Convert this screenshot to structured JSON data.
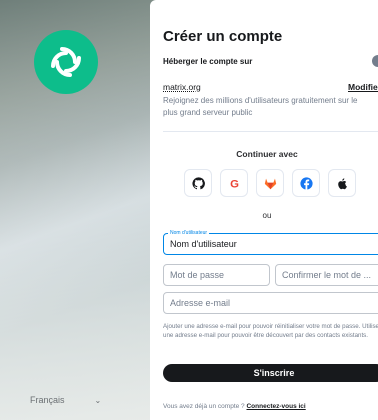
{
  "colors": {
    "accent": "#0dbd8b",
    "primary_button": "#17191c",
    "focus": "#0086e6"
  },
  "language": {
    "selected": "Français"
  },
  "form": {
    "title": "Créer un compte",
    "host_label": "Héberger le compte sur",
    "server_name": "matrix.org",
    "modify_label": "Modifier",
    "server_description": "Rejoignez des millions d'utilisateurs gratuitement sur le plus grand serveur public",
    "continue_with": "Continuer avec",
    "sso_providers": [
      "github-icon",
      "google-icon",
      "gitlab-icon",
      "facebook-icon",
      "apple-icon"
    ],
    "or_label": "ou",
    "username_floating_label": "Nom d'utilisateur",
    "username_placeholder": "Nom d'utilisateur",
    "password_placeholder": "Mot de passe",
    "confirm_password_placeholder": "Confirmer le mot de ...",
    "email_placeholder": "Adresse e-mail",
    "email_hint": "Ajouter une adresse e-mail pour pouvoir réinitialiser votre mot de passe. Utiliser une adresse e-mail pour pouvoir être découvert par des contacts existants.",
    "submit_label": "S'inscrire",
    "have_account_text": "Vous avez déjà un compte ?",
    "sign_in_link": "Connectez-vous ici"
  }
}
